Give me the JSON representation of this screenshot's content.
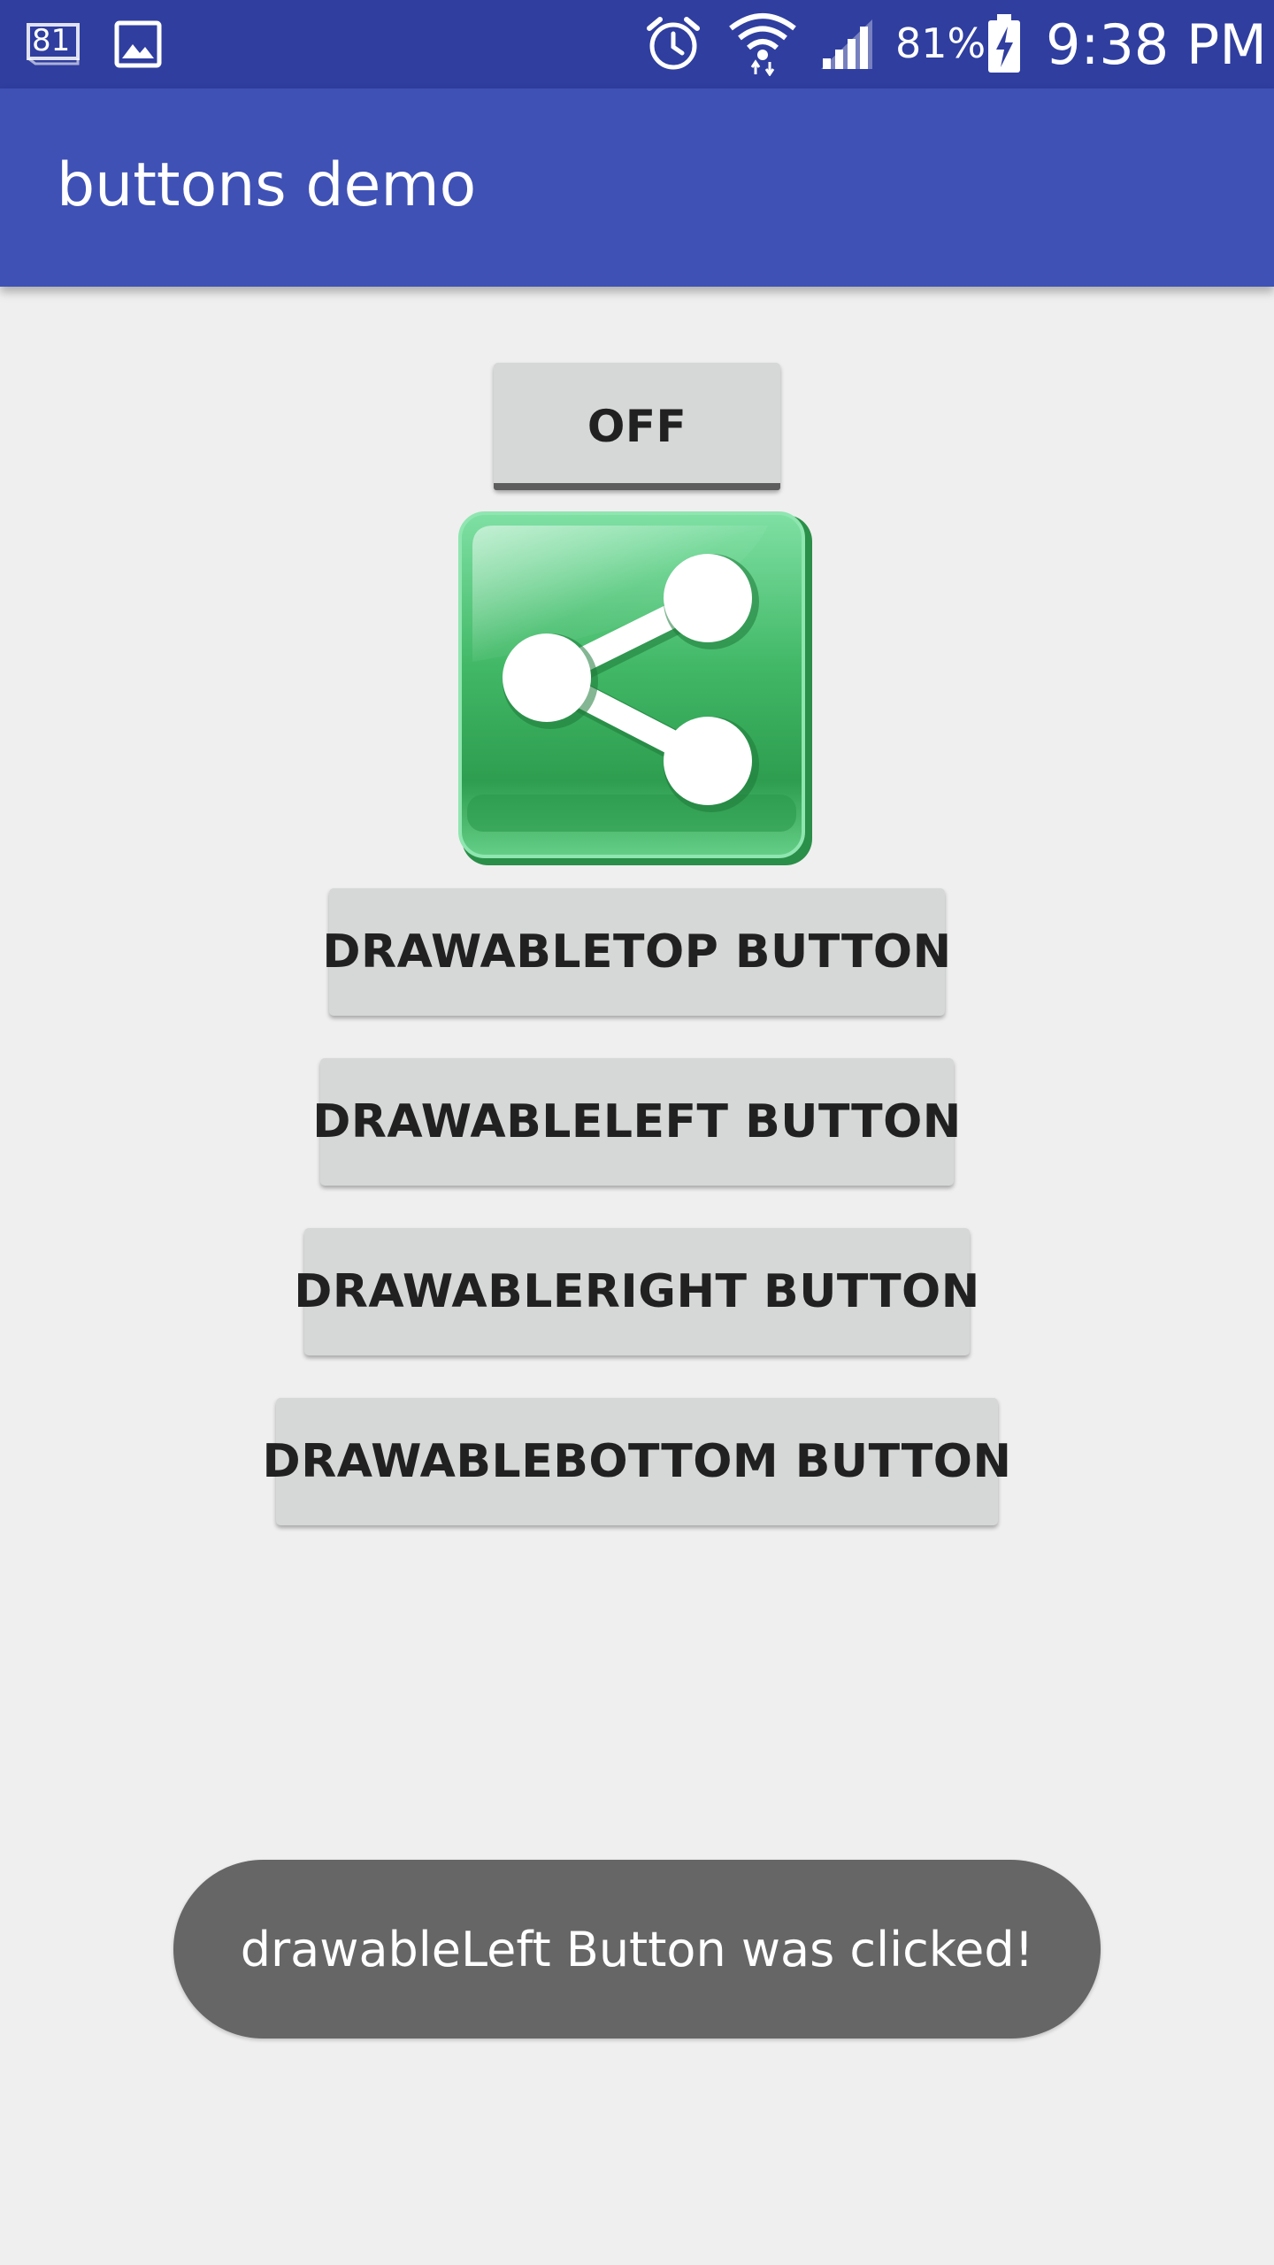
{
  "status_bar": {
    "time": "9:38 PM",
    "battery_percent": "81%",
    "notification_badge": "81",
    "icons": [
      "calendar-81-icon",
      "image-icon",
      "alarm-icon",
      "wifi-icon",
      "signal-icon",
      "battery-charging-icon"
    ]
  },
  "app_bar": {
    "title": "buttons demo",
    "color": "#3f51b5"
  },
  "colors": {
    "status_bar": "#2f3e9f",
    "background": "#efefef",
    "button": "#d6d7d7",
    "share_green": "#3ab35c",
    "toast": "#666666"
  },
  "buttons": {
    "toggle": {
      "label": "OFF",
      "checked": false
    },
    "share_icon": "share-icon",
    "drawable_top": {
      "label": "DRAWABLETOP BUTTON"
    },
    "drawable_left": {
      "label": "DRAWABLELEFT BUTTON"
    },
    "drawable_right": {
      "label": "DRAWABLERIGHT BUTTON"
    },
    "drawable_bottom": {
      "label": "DRAWABLEBOTTOM BUTTON"
    }
  },
  "toast": {
    "message": "drawableLeft Button was clicked!"
  }
}
